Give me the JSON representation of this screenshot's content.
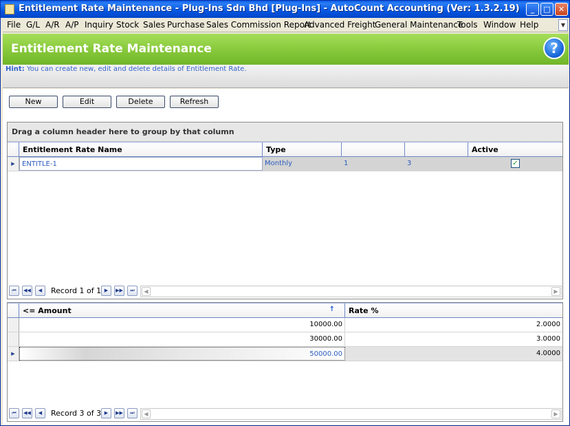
{
  "window": {
    "title": "Entitlement Rate Maintenance - Plug-Ins Sdn Bhd [Plug-Ins] - AutoCount Accounting (Ver: 1.3.2.19)",
    "min": "_",
    "max": "□",
    "close": "✕"
  },
  "menu": [
    "File",
    "G/L",
    "A/R",
    "A/P",
    "Inquiry",
    "Stock",
    "Sales",
    "Purchase",
    "Sales Commission Report",
    "Advanced Freight",
    "General Maintenance",
    "Tools",
    "Window",
    "Help"
  ],
  "header": {
    "title": "Entitlement Rate Maintenance",
    "help": "?"
  },
  "hint": {
    "label": "Hint:",
    "text": "You can create new, edit and delete details of Entitlement Rate."
  },
  "toolbar": {
    "new": "New",
    "edit": "Edit",
    "delete": "Delete",
    "refresh": "Refresh"
  },
  "grid1": {
    "group_prompt": "Drag a column header here to group by that column",
    "columns": [
      "Entitlement Rate Name",
      "Type",
      "",
      "",
      "Active"
    ],
    "rows": [
      {
        "name": "ENTITLE-1",
        "type": "Monthly",
        "c3": "1",
        "c4": "3",
        "active": true
      }
    ],
    "record": "Record 1 of 1"
  },
  "grid2": {
    "columns": [
      "<= Amount",
      "Rate %"
    ],
    "rows": [
      {
        "amount": "10000.00",
        "rate": "2.0000"
      },
      {
        "amount": "30000.00",
        "rate": "3.0000"
      },
      {
        "amount": "50000.00",
        "rate": "4.0000"
      }
    ],
    "record": "Record 3 of 3"
  },
  "icons": {
    "first": "first-icon",
    "prev_page": "prev-page-icon",
    "prev": "prev-icon",
    "next": "next-icon",
    "next_page": "next-page-icon",
    "last": "last-icon"
  },
  "colors": {
    "header_green": "#86c83a",
    "title_blue": "#0556e0",
    "link_blue": "#2b5bbd"
  }
}
